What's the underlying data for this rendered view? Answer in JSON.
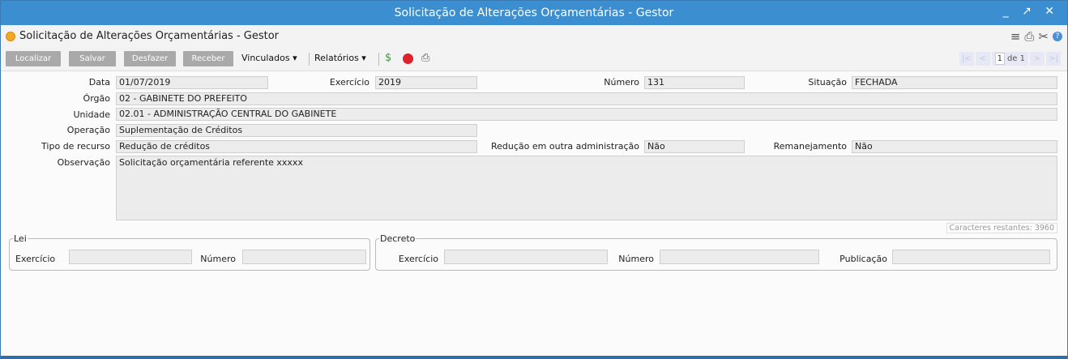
{
  "window": {
    "title": "Solicitação de Alterações Orçamentárias - Gestor",
    "controls": "_ ↗ ✕"
  },
  "header": {
    "title": "Solicitação de Alterações Orçamentárias - Gestor"
  },
  "toolbar": {
    "buttons": [
      "Localizar",
      "Salvar",
      "Desfazer",
      "Receber"
    ],
    "menus": [
      "Vinculados ▾",
      "Relatórios ▾"
    ],
    "pager": {
      "first": "|<",
      "prev": "<",
      "current": "1",
      "of_label": "de 1",
      "next": ">",
      "last": ">|"
    }
  },
  "form": {
    "data": {
      "label": "Data",
      "value": "01/07/2019"
    },
    "exercicio": {
      "label": "Exercício",
      "value": "2019"
    },
    "numero": {
      "label": "Número",
      "value": "131"
    },
    "situacao": {
      "label": "Situação",
      "value": "FECHADA"
    },
    "orgao": {
      "label": "Órgão",
      "value": "02 - GABINETE DO PREFEITO"
    },
    "unidade": {
      "label": "Unidade",
      "value": "02.01 - ADMINISTRAÇÃO CENTRAL DO GABINETE"
    },
    "operacao": {
      "label": "Operação",
      "value": "Suplementação de Créditos"
    },
    "tipo_recurso": {
      "label": "Tipo de recurso",
      "value": "Redução de créditos"
    },
    "reducao_outra": {
      "label": "Redução em outra administração",
      "value": "Não"
    },
    "remanejamento": {
      "label": "Remanejamento",
      "value": "Não"
    },
    "observacao": {
      "label": "Observação",
      "value": "Solicitação orçamentária referente xxxxx"
    },
    "caracteres_restantes": "Caracteres restantes: 3960"
  },
  "lei": {
    "legend": "Lei",
    "exercicio_label": "Exercício",
    "exercicio_value": "",
    "numero_label": "Número",
    "numero_value": ""
  },
  "decreto": {
    "legend": "Decreto",
    "exercicio_label": "Exercício",
    "exercicio_value": "",
    "numero_label": "Número",
    "numero_value": "",
    "publicacao_label": "Publicação",
    "publicacao_value": ""
  }
}
